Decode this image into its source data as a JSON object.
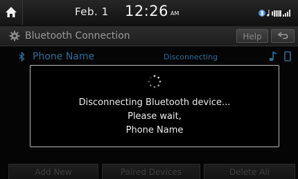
{
  "status_bar": {
    "date": "Feb.  1",
    "time": "12:26",
    "ampm": "AM"
  },
  "title_bar": {
    "title": "Bluetooth Connection",
    "help_label": "Help"
  },
  "device": {
    "name": "Phone Name",
    "status": "Disconnecting"
  },
  "dialog": {
    "line1": "Disconnecting Bluetooth device...",
    "line2": "Please wait,",
    "line3": "Phone Name"
  },
  "bottom_buttons": {
    "add_new": "Add New",
    "paired_devices": "Paired Devices",
    "delete_all": "Delete All"
  },
  "colors": {
    "accent_blue": "#2c6d99",
    "background": "#050506",
    "dialog_border": "#b9b9b9"
  }
}
